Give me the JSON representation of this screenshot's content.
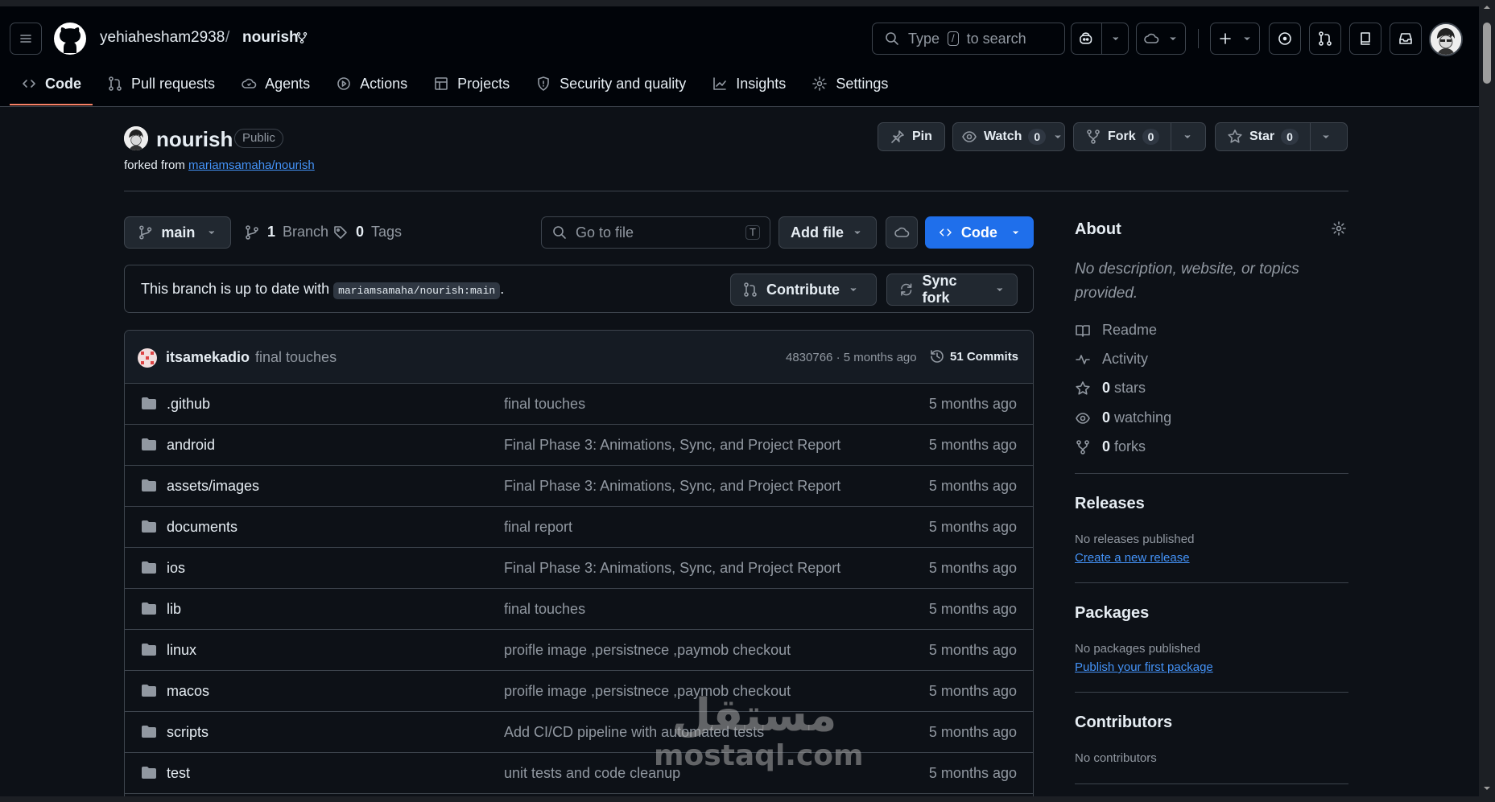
{
  "header": {
    "owner": "yehiahesham2938",
    "separator": "/",
    "repo": "nourish",
    "search_prefix": "Type",
    "search_key": "/",
    "search_suffix": "to search"
  },
  "tabs": [
    {
      "label": "Code",
      "icon": "code-icon"
    },
    {
      "label": "Pull requests",
      "icon": "pull-request-icon"
    },
    {
      "label": "Agents",
      "icon": "agents-icon"
    },
    {
      "label": "Actions",
      "icon": "play-icon"
    },
    {
      "label": "Projects",
      "icon": "table-icon"
    },
    {
      "label": "Security and quality",
      "icon": "shield-icon"
    },
    {
      "label": "Insights",
      "icon": "graph-icon"
    },
    {
      "label": "Settings",
      "icon": "gear-icon"
    }
  ],
  "repo": {
    "name": "nourish",
    "visibility": "Public",
    "forked_prefix": "forked from",
    "forked_from": "mariamsamaha/nourish",
    "pin_label": "Pin",
    "watch_label": "Watch",
    "watch_count": "0",
    "fork_label": "Fork",
    "fork_count": "0",
    "star_label": "Star",
    "star_count": "0"
  },
  "filenav": {
    "branch": "main",
    "branches_count": "1",
    "branches_label": "Branch",
    "tags_count": "0",
    "tags_label": "Tags",
    "goto_placeholder": "Go to file",
    "goto_key": "T",
    "add_file": "Add file",
    "code": "Code"
  },
  "status": {
    "message": "This branch is up to date with",
    "ref": "mariamsamaha/nourish:main",
    "period": ".",
    "contribute": "Contribute",
    "sync": "Sync fork"
  },
  "latest_commit": {
    "author": "itsamekadio",
    "message": "final touches",
    "hash_time": "4830766 · 5 months ago",
    "commits": "51 Commits"
  },
  "files": [
    {
      "name": ".github",
      "message": "final touches",
      "time": "5 months ago"
    },
    {
      "name": "android",
      "message": "Final Phase 3: Animations, Sync, and Project Report",
      "time": "5 months ago"
    },
    {
      "name": "assets/images",
      "message": "Final Phase 3: Animations, Sync, and Project Report",
      "time": "5 months ago"
    },
    {
      "name": "documents",
      "message": "final report",
      "time": "5 months ago"
    },
    {
      "name": "ios",
      "message": "Final Phase 3: Animations, Sync, and Project Report",
      "time": "5 months ago"
    },
    {
      "name": "lib",
      "message": "final touches",
      "time": "5 months ago"
    },
    {
      "name": "linux",
      "message": "proifle image ,persistnece ,paymob checkout",
      "time": "5 months ago"
    },
    {
      "name": "macos",
      "message": "proifle image ,persistnece ,paymob checkout",
      "time": "5 months ago"
    },
    {
      "name": "scripts",
      "message": "Add CI/CD pipeline with automated tests",
      "time": "5 months ago"
    },
    {
      "name": "test",
      "message": "unit tests and code cleanup",
      "time": "5 months ago"
    }
  ],
  "about": {
    "title": "About",
    "description": "No description, website, or topics provided.",
    "readme": "Readme",
    "activity": "Activity",
    "stars_count": "0",
    "stars_label": "stars",
    "watching_count": "0",
    "watching_label": "watching",
    "forks_count": "0",
    "forks_label": "forks"
  },
  "releases": {
    "title": "Releases",
    "empty": "No releases published",
    "link": "Create a new release"
  },
  "packages": {
    "title": "Packages",
    "empty": "No packages published",
    "link": "Publish your first package"
  },
  "contributors": {
    "title": "Contributors",
    "empty": "No contributors"
  },
  "watermark": {
    "arabic": "مستقل",
    "latin": "mostaql.com"
  },
  "colors": {
    "accent": "#1f6feb",
    "link": "#4493f8",
    "tab_underline": "#f78166",
    "background": "#0d1117"
  }
}
